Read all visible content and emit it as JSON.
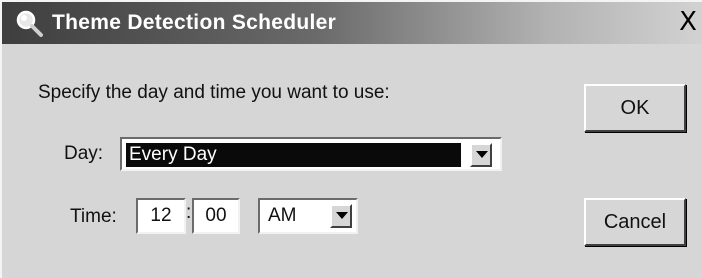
{
  "window": {
    "title": "Theme Detection Scheduler",
    "close_label": "X",
    "app_icon": "magnifier-icon"
  },
  "form": {
    "prompt": "Specify the day and time you want to use:",
    "day_label": "Day:",
    "day_value": "Every Day",
    "time_label": "Time:",
    "hour": "12",
    "separator": ":",
    "minute": "00",
    "ampm": "AM"
  },
  "buttons": {
    "ok": "OK",
    "cancel": "Cancel"
  },
  "colors": {
    "titlebar_start": "#3e3e3e",
    "titlebar_end": "#d2d2d2",
    "dialog_bg": "#d6d6d6",
    "selection_bg": "#0a0a0a"
  }
}
